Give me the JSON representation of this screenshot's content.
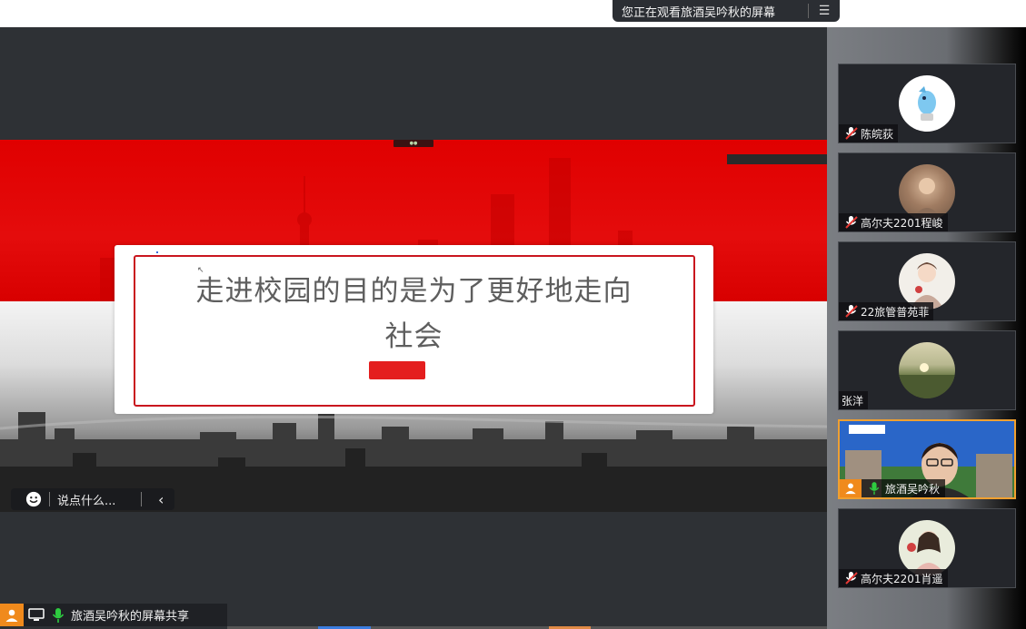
{
  "top_banner": {
    "text": "您正在观看旅酒吴吟秋的屏幕",
    "menu_icon": "list-menu-icon"
  },
  "slide": {
    "line1": "走进校园的目的是为了更好地走向",
    "line2": "社会"
  },
  "chat": {
    "placeholder": "说点什么..."
  },
  "share_label": {
    "text": "旅酒吴吟秋的屏幕共享"
  },
  "participants": [
    {
      "name": "陈皖荻",
      "mic": "muted",
      "avatar": "cartoon-avatar"
    },
    {
      "name": "高尔夫2201程峻",
      "mic": "muted",
      "avatar": "photo-avatar"
    },
    {
      "name": "22旅管普苑菲",
      "mic": "muted",
      "avatar": "photo-avatar"
    },
    {
      "name": "张洋",
      "mic": "none",
      "avatar": "landscape-avatar"
    },
    {
      "name": "旅酒吴吟秋",
      "mic": "active",
      "avatar": "video-feed"
    },
    {
      "name": "高尔夫2201肖遥",
      "mic": "muted",
      "avatar": "photo-avatar"
    }
  ],
  "colors": {
    "accent_red": "#e00000",
    "sidebar_dark": "#24262b",
    "user_orange": "#f08a1c",
    "mic_green": "#2ecc40"
  }
}
